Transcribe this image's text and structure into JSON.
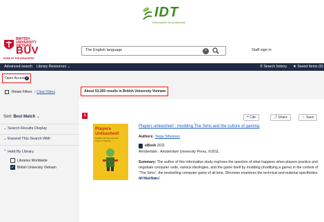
{
  "banner": {
    "logo_text": "IDT",
    "tagline": "Think inspired. Act professional"
  },
  "header": {
    "logo_small": "BRITISH UNIVERSITY VIETNAM",
    "logo_big": "BUV",
    "logo_tagline": "HOME OF THE UNDAUNTED",
    "search_value": "The English language",
    "staff_signin": "Staff sign in"
  },
  "nav": {
    "advanced_search": "Advanced search",
    "library_resources": "Library Resources",
    "search_history": "Search history",
    "saved_items": "Saved Items (0)"
  },
  "filters": {
    "open_access": "Open Access",
    "retain_filters": "Retain Filters",
    "separator": "|",
    "clear_filters": "Clear Filters",
    "results_count": "About 53,300 results in British University Vietnam"
  },
  "sidebar": {
    "sort_label": "Sort:",
    "sort_value": "Best Match",
    "search_results_display": "Search Results Display",
    "expand_search": "Expand This Search With",
    "held_by_library": "Held By Library",
    "libraries": [
      {
        "label": "Libraries Worldwide",
        "checked": false
      },
      {
        "label": "British University Vietnam",
        "checked": true
      }
    ]
  },
  "result": {
    "index": "1",
    "cite": "Cite",
    "share": "Share",
    "save": "Save",
    "cover_title": "Players Unleashed!",
    "cover_subtitle": "Modding The Sims and the Culture of Gaming",
    "title": "Players unleashed! : modding The Sims and the culture of gaming",
    "authors_label": "Authors:",
    "author": "Tanja Sihvonen",
    "type": "eBook",
    "year": "2011",
    "publisher": "Amsterdam : Amsterdam University Press, ©2011.",
    "summary_label": "Summary:",
    "summary": "The author of this informative study explores the question of what happens when players practice and negotiate computer code, various ideologies, and the game itself by modding (modifying a game) in the context of \"The Sims\", the bestselling computer game of all time. Sihvonen examines the technical and material specificities of \"The Sims\"",
    "show_more": "Show More"
  },
  "colors": {
    "brand_red": "#c8102e",
    "nav_navy": "#1f2a44",
    "link_blue": "#1a5bb8",
    "highlight_red": "#ee1111",
    "idt_green": "#3b8a1f"
  }
}
